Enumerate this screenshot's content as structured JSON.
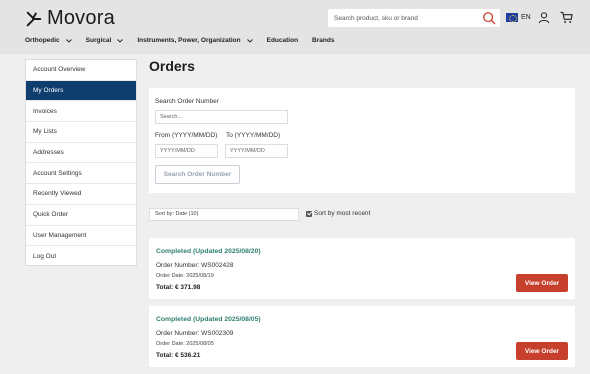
{
  "brand": {
    "name": "Movora"
  },
  "search": {
    "placeholder": "Search product, sku or brand"
  },
  "lang": {
    "code": "EN"
  },
  "nav": {
    "items": [
      {
        "label": "Orthopedic",
        "dropdown": true
      },
      {
        "label": "Surgical",
        "dropdown": true
      },
      {
        "label": "Instruments, Power, Organization",
        "dropdown": true
      },
      {
        "label": "Education",
        "dropdown": false
      },
      {
        "label": "Brands",
        "dropdown": false
      }
    ]
  },
  "sidebar": {
    "items": [
      {
        "label": "Account Overview"
      },
      {
        "label": "My Orders",
        "active": true
      },
      {
        "label": "Invoices"
      },
      {
        "label": "My Lists"
      },
      {
        "label": "Addresses"
      },
      {
        "label": "Account Settings"
      },
      {
        "label": "Recently Viewed"
      },
      {
        "label": "Quick Order"
      },
      {
        "label": "User Management"
      },
      {
        "label": "Log Out"
      }
    ]
  },
  "page": {
    "title": "Orders"
  },
  "order_search": {
    "label": "Search Order Number",
    "placeholder": "Search...",
    "from_label": "From (YYYY/MM/DD)",
    "from_placeholder": "YYYY/MM/DD",
    "to_label": "To (YYYY/MM/DD)",
    "to_placeholder": "YYYY/MM/DD",
    "button": "Search Order Number"
  },
  "sort": {
    "select_value": "Sort by: Date (10)",
    "checkbox_label": "Sort by most recent",
    "checked": true
  },
  "orders": [
    {
      "status": "Completed (Updated 2025/08/20)",
      "number": "Order Number: WS002428",
      "date": "Order Date: 2025/08/19",
      "total": "Total: € 371.98",
      "button": "View Order"
    },
    {
      "status": "Completed (Updated 2025/08/05)",
      "number": "Order Number: WS002309",
      "date": "Order Date: 2025/08/05",
      "total": "Total: € 536.21",
      "button": "View Order"
    }
  ],
  "colors": {
    "active_nav": "#0e3d6e",
    "status_green": "#2f7f6f",
    "view_button": "#c7402d"
  }
}
